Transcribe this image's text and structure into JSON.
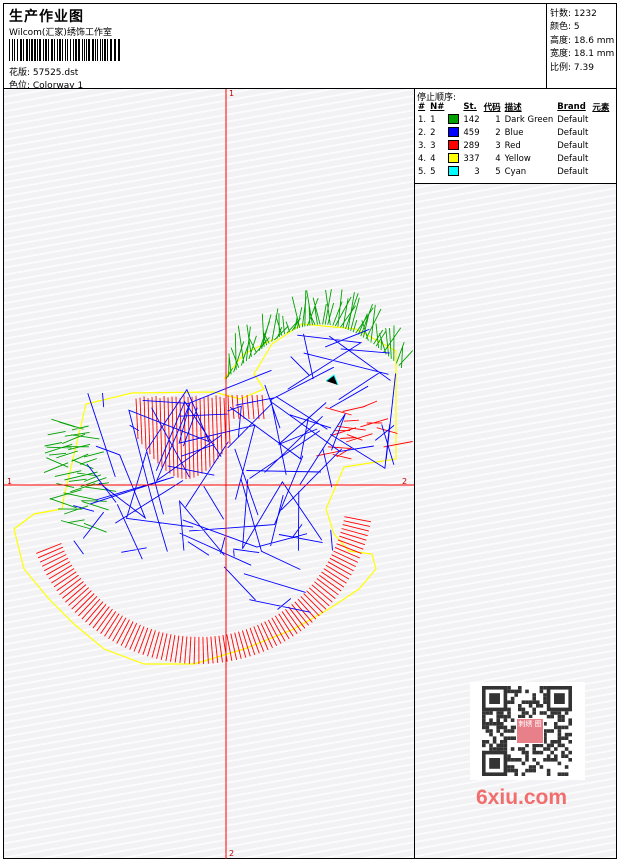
{
  "header": {
    "title": "生产作业图",
    "studio": "Wilcom(汇家)绣饰工作室",
    "design_label": "花版: 57525.dst",
    "colorway_label": "色位: Colorway 1"
  },
  "stats": {
    "stitches": "针数: 1232",
    "colors": "颜色: 5",
    "height": "高度: 18.6 mm",
    "width": "宽度: 18.1 mm",
    "scale": "比例: 7.39"
  },
  "legend": {
    "title": "停止顺序:",
    "headers": [
      "#",
      "N#",
      "St.",
      "代码",
      "描述",
      "Brand",
      "元素"
    ],
    "rows": [
      {
        "n": "1.",
        "num": "1",
        "color": "#00a000",
        "st": "142",
        "code": "1",
        "desc": "Dark Green",
        "brand": "Default"
      },
      {
        "n": "2.",
        "num": "2",
        "color": "#0000ff",
        "st": "459",
        "code": "2",
        "desc": "Blue",
        "brand": "Default"
      },
      {
        "n": "3.",
        "num": "3",
        "color": "#ff0000",
        "st": "289",
        "code": "3",
        "desc": "Red",
        "brand": "Default"
      },
      {
        "n": "4.",
        "num": "4",
        "color": "#ffff00",
        "st": "337",
        "code": "4",
        "desc": "Yellow",
        "brand": "Default"
      },
      {
        "n": "5.",
        "num": "5",
        "color": "#00ffff",
        "st": "3",
        "code": "5",
        "desc": "Cyan",
        "brand": "Default"
      }
    ]
  },
  "axis_labels": {
    "top": "1",
    "bottom": "2",
    "left": "1",
    "right": "2"
  },
  "watermark": "6xiu.com",
  "qr_stamp": "刺绣 图"
}
